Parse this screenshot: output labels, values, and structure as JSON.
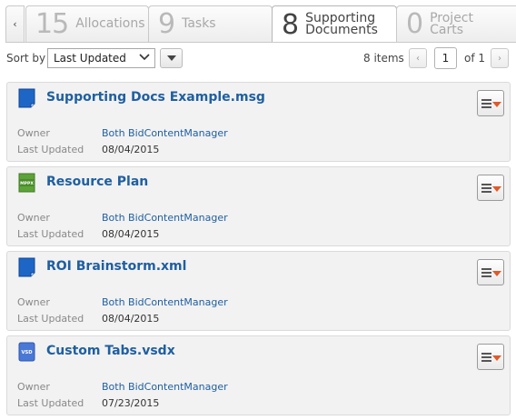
{
  "tabs": {
    "prev_arrow": "‹",
    "items": [
      {
        "count": "15",
        "label": "Allocations",
        "active": false
      },
      {
        "count": "9",
        "label": "Tasks",
        "active": false
      },
      {
        "count": "8",
        "label_line1": "Supporting",
        "label_line2": "Documents",
        "active": true
      },
      {
        "count": "0",
        "label_line1": "Project",
        "label_line2": "Carts",
        "active": false
      }
    ]
  },
  "toolbar": {
    "sort_label": "Sort by",
    "sort_value": "Last Updated",
    "items_count": "8 items",
    "page_prev": "‹",
    "page_current": "1",
    "page_of": "of 1",
    "page_next": "›"
  },
  "meta_labels": {
    "owner": "Owner",
    "updated": "Last Updated"
  },
  "documents": [
    {
      "title": "Supporting Docs Example.msg",
      "icon": "msg-file-icon",
      "owner": "Both BidContentManager",
      "updated": "08/04/2015"
    },
    {
      "title": "Resource Plan",
      "icon": "mpp-file-icon",
      "icon_text": "MPPX",
      "owner": "Both BidContentManager",
      "updated": "08/04/2015"
    },
    {
      "title": "ROI Brainstorm.xml",
      "icon": "xml-file-icon",
      "owner": "Both BidContentManager",
      "updated": "08/04/2015"
    },
    {
      "title": "Custom Tabs.vsdx",
      "icon": "vsd-file-icon",
      "icon_text": "VSD",
      "owner": "Both BidContentManager",
      "updated": "07/23/2015"
    }
  ],
  "colors": {
    "link": "#1f5fa0",
    "menu_arrow": "#e0592a"
  }
}
